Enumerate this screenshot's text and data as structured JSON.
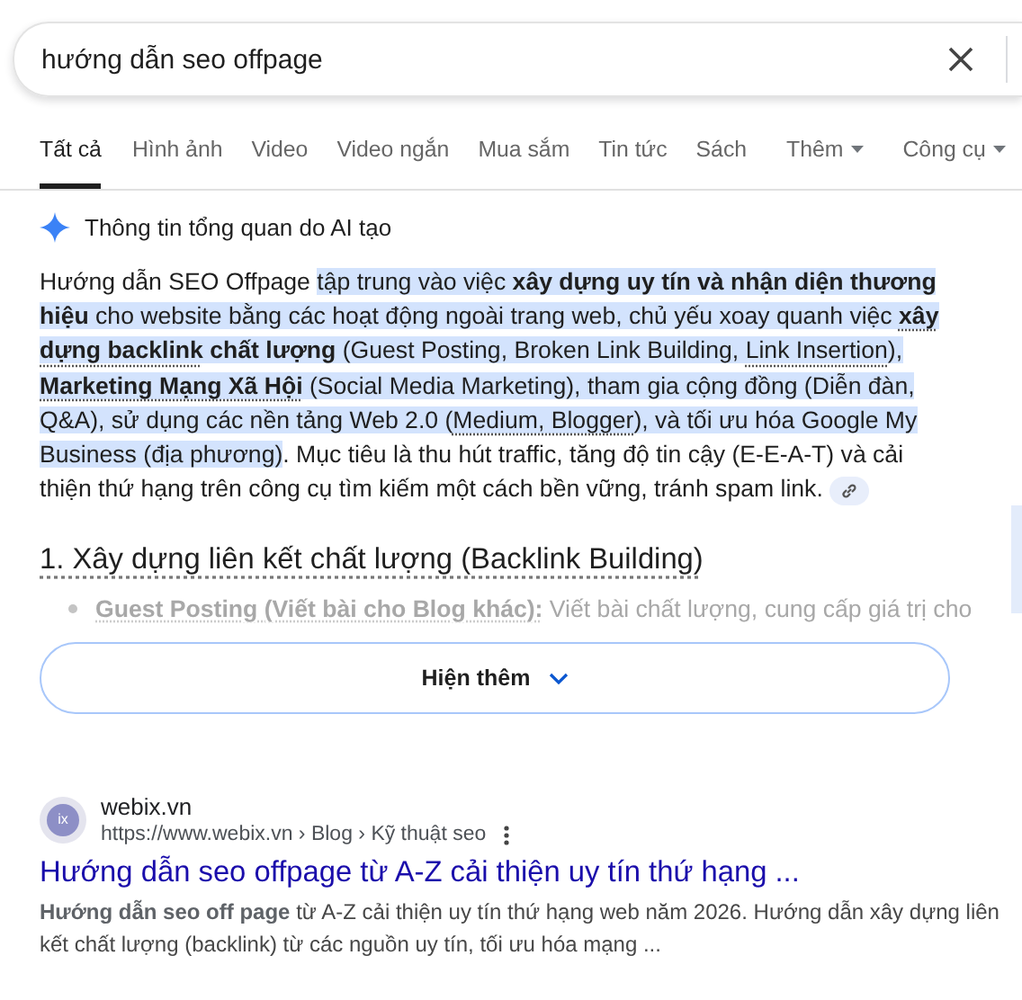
{
  "search": {
    "value": "hướng dẫn seo offpage"
  },
  "tabs": [
    {
      "label": "Tất cả",
      "selected": true,
      "kind": "tab"
    },
    {
      "label": "Hình ảnh",
      "selected": false,
      "kind": "tab"
    },
    {
      "label": "Video",
      "selected": false,
      "kind": "tab"
    },
    {
      "label": "Video ngắn",
      "selected": false,
      "kind": "tab"
    },
    {
      "label": "Mua sắm",
      "selected": false,
      "kind": "tab"
    },
    {
      "label": "Tin tức",
      "selected": false,
      "kind": "tab"
    },
    {
      "label": "Sách",
      "selected": false,
      "kind": "tab"
    },
    {
      "label": "Thêm",
      "selected": false,
      "kind": "menu"
    },
    {
      "label": "Công cụ",
      "selected": false,
      "kind": "menu"
    }
  ],
  "ai_overview": {
    "title": "Thông tin tổng quan do AI tạo",
    "summary": [
      {
        "text": "Hướng dẫn SEO Offpage ",
        "highlighted": false,
        "underlined": false
      },
      {
        "text": "tập trung vào việc **xây dựng uy tín và nhận diện thương hiệu** cho website bằng các hoạt động ngoài trang web, chủ yếu xoay quanh việc ",
        "highlighted": true,
        "underlined": false
      },
      {
        "text": "**xây dựng backlink**",
        "highlighted": true,
        "underlined": true
      },
      {
        "text": " **chất lượng** (Guest Posting, Broken Link Building, ",
        "highlighted": true,
        "underlined": false
      },
      {
        "text": "Link Insertion",
        "highlighted": true,
        "underlined": true
      },
      {
        "text": "), ",
        "highlighted": true,
        "underlined": false
      },
      {
        "text": "**Marketing Mạng Xã Hội**",
        "highlighted": true,
        "underlined": true
      },
      {
        "text": " (Social Media Marketing), tham gia cộng đồng (Diễn đàn, Q&A), sử dụng các nền tảng Web 2.0 (",
        "highlighted": true,
        "underlined": false
      },
      {
        "text": "Medium, Blogger",
        "highlighted": true,
        "underlined": true
      },
      {
        "text": "), và tối ưu hóa Google My Business (địa phương)",
        "highlighted": true,
        "underlined": false
      },
      {
        "text": ". Mục tiêu là thu hút traffic, tăng độ tin cậy (E-E-A-T) và cải thiện thứ hạng trên công cụ tìm kiếm một cách bền vững, tránh spam link.",
        "highlighted": false,
        "underlined": false
      }
    ],
    "heading": "1. Xây dựng liên kết chất lượng (Backlink Building)",
    "bullet": {
      "term": "Guest Posting (Viết bài cho Blog khác):",
      "text": " Viết bài chất lượng, cung cấp giá trị cho"
    },
    "show_more": "Hiện thêm"
  },
  "result": {
    "favicon_text": "ix",
    "site": "webix.vn",
    "url": "https://www.webix.vn › Blog › Kỹ thuật seo",
    "title": "Hướng dẫn seo offpage từ A-Z cải thiện uy tín thứ hạng ...",
    "snippet": "**Hướng dẫn seo off page** từ A-Z cải thiện uy tín thứ hạng web năm 2026. Hướng dẫn xây dựng liên kết chất lượng (backlink) từ các nguồn uy tín, tối ưu hóa mạng ..."
  }
}
